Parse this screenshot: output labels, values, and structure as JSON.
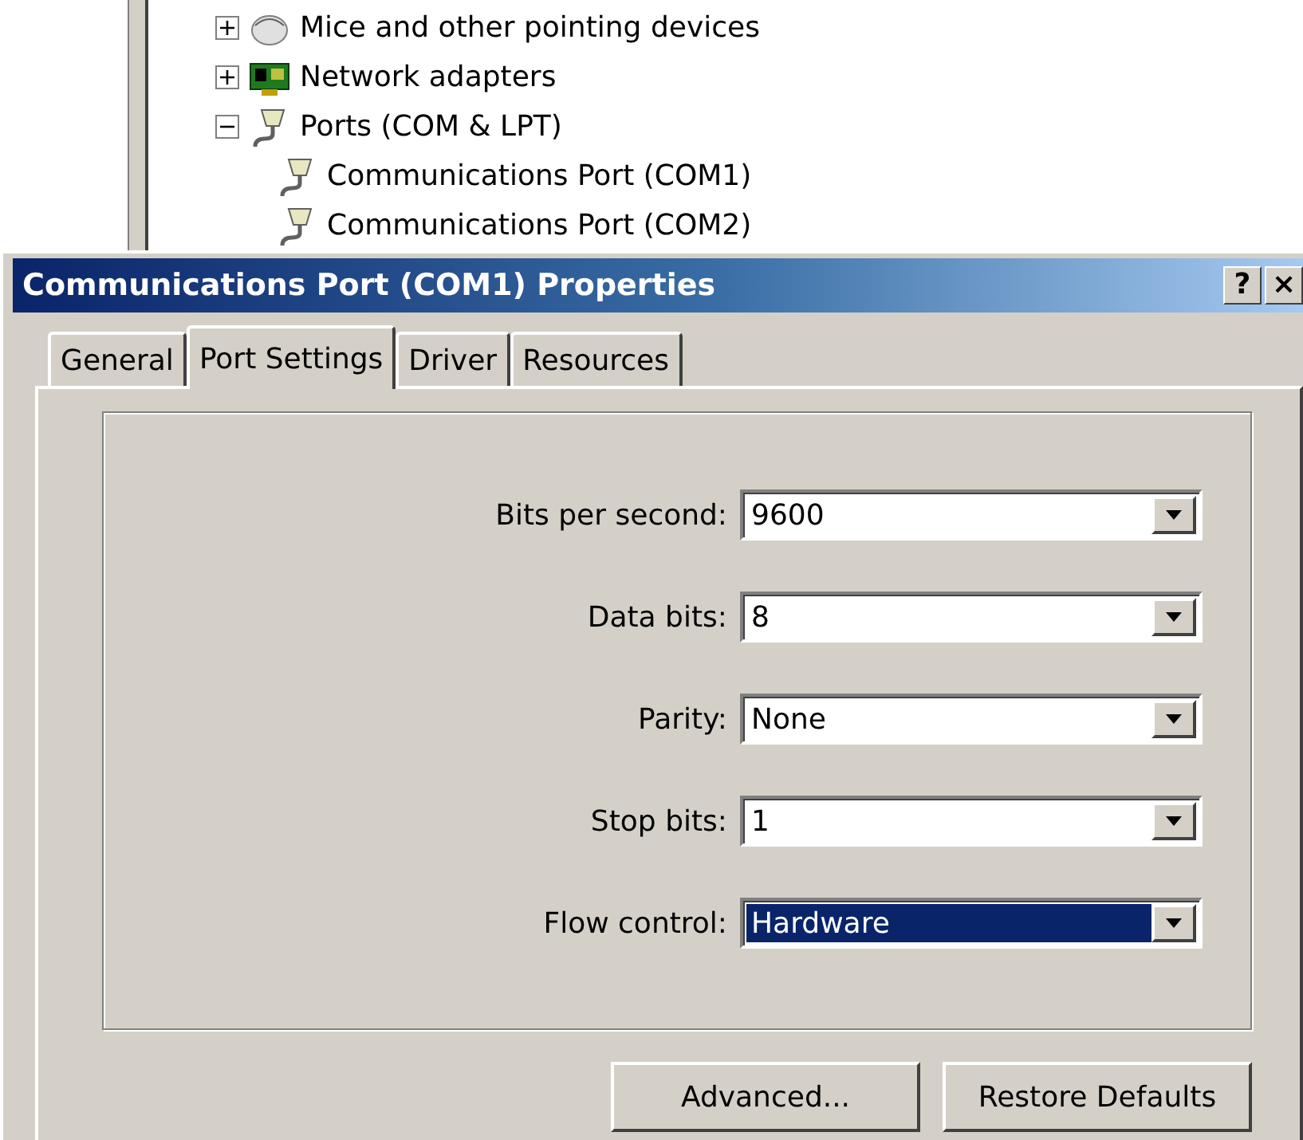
{
  "device_tree": {
    "items": [
      {
        "label": "Mice and other pointing devices",
        "kind": "mouse",
        "expanded": false
      },
      {
        "label": "Network adapters",
        "kind": "network",
        "expanded": false
      },
      {
        "label": "Ports (COM & LPT)",
        "kind": "port",
        "expanded": true,
        "children": [
          {
            "label": "Communications Port (COM1)",
            "kind": "port"
          },
          {
            "label": "Communications Port (COM2)",
            "kind": "port"
          }
        ]
      }
    ]
  },
  "window": {
    "title": "Communications Port (COM1) Properties",
    "title_buttons": [
      "?",
      "×"
    ]
  },
  "tabs": [
    {
      "label": "General",
      "selected": false
    },
    {
      "label": "Port Settings",
      "selected": true
    },
    {
      "label": "Driver",
      "selected": false
    },
    {
      "label": "Resources",
      "selected": false
    }
  ],
  "fields": [
    {
      "label": "Bits per second:",
      "value": "9600",
      "highlighted": false
    },
    {
      "label": "Data bits:",
      "value": "8",
      "highlighted": false
    },
    {
      "label": "Parity:",
      "value": "None",
      "highlighted": false
    },
    {
      "label": "Stop bits:",
      "value": "1",
      "highlighted": false
    },
    {
      "label": "Flow control:",
      "value": "Hardware",
      "highlighted": true
    }
  ],
  "buttons": [
    "Advanced...",
    "Restore Defaults"
  ]
}
